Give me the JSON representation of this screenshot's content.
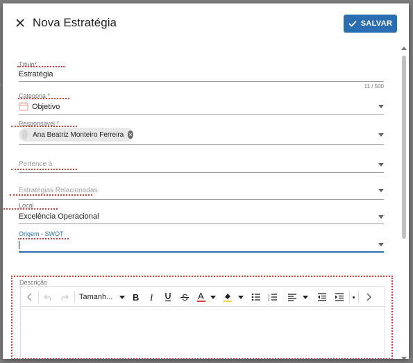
{
  "dialog": {
    "title": "Nova Estratégia",
    "save_label": "SALVAR",
    "accent_color": "#2a6eb1",
    "annotation_color": "#e53935"
  },
  "fields": {
    "titulo": {
      "label": "Título*",
      "value": "Estratégia",
      "counter": "11 / 500"
    },
    "categoria": {
      "label": "Categoria *",
      "value": "Objetivo",
      "icon": "calendar-icon"
    },
    "responsavel": {
      "label": "Responsável *",
      "chip": "Ana Beatriz Monteiro Ferreira"
    },
    "pertence": {
      "placeholder": "Pertence à"
    },
    "relacionadas": {
      "placeholder": "Estratégias Relacionadas"
    },
    "local": {
      "label": "Local",
      "value": "Excelência Operacional"
    },
    "origem": {
      "label": "Origem - SWOT",
      "value": ""
    }
  },
  "descricao": {
    "label": "Descrição",
    "font_size_select": "Tamanh...",
    "toolbar_icons": [
      "chevron-left-icon",
      "undo-icon",
      "redo-icon",
      "font-size-select",
      "bold-icon",
      "italic-icon",
      "underline-icon",
      "strikethrough-icon",
      "font-color-icon",
      "highlight-icon",
      "bullet-list-icon",
      "numbered-list-icon",
      "align-icon",
      "outdent-icon",
      "indent-icon",
      "chevron-right-icon"
    ]
  }
}
